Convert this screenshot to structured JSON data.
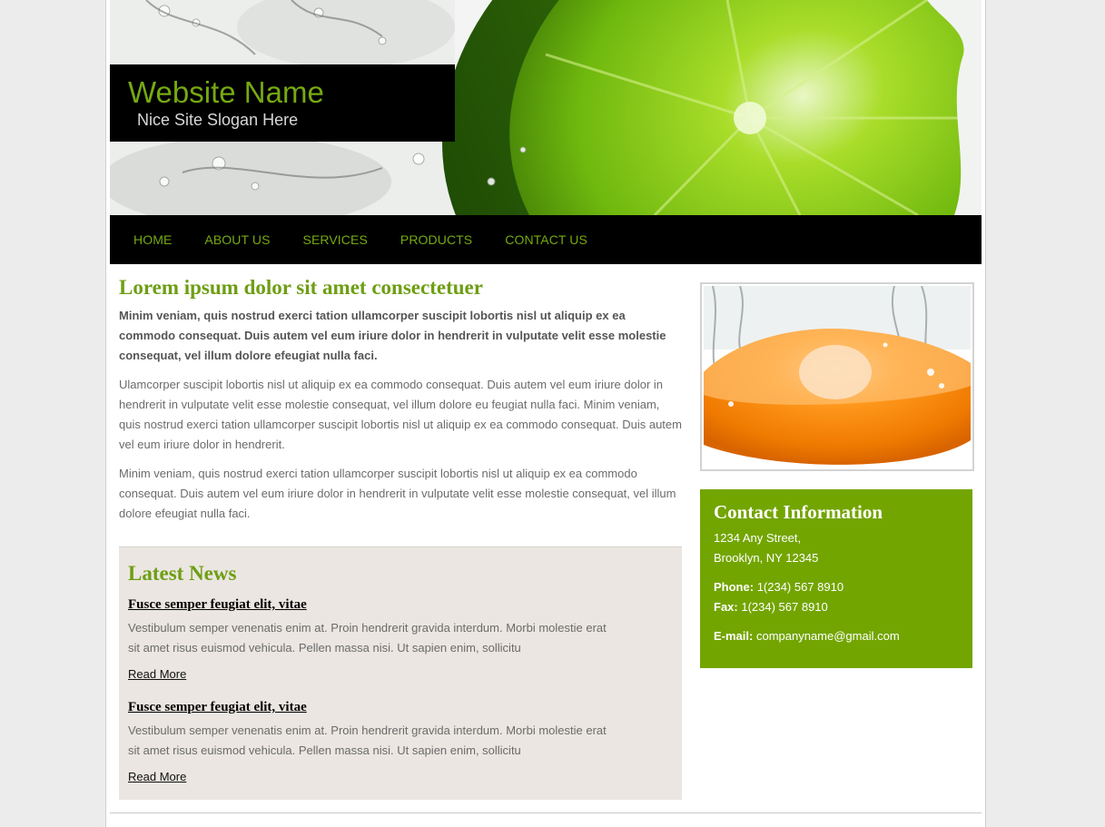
{
  "header": {
    "site_name": "Website Name",
    "slogan": "Nice Site Slogan Here"
  },
  "nav": {
    "items": [
      "HOME",
      "ABOUT US",
      "SERVICES",
      "PRODUCTS",
      "CONTACT US"
    ]
  },
  "main": {
    "headline": "Lorem ipsum dolor sit amet consectetuer",
    "intro": "Minim veniam, quis nostrud exerci tation ullamcorper suscipit lobortis nisl ut aliquip ex ea commodo consequat. Duis autem vel eum iriure dolor in hendrerit in vulputate velit esse molestie consequat, vel illum dolore efeugiat nulla faci.",
    "paragraphs": [
      "Ulamcorper suscipit lobortis nisl ut aliquip ex ea commodo consequat. Duis autem vel eum iriure dolor in hendrerit in vulputate velit esse molestie consequat, vel illum dolore eu feugiat nulla faci. Minim veniam, quis nostrud exerci tation ullamcorper suscipit lobortis nisl ut aliquip ex ea commodo consequat. Duis autem vel eum iriure dolor in hendrerit.",
      "Minim veniam, quis nostrud exerci tation ullamcorper suscipit lobortis nisl ut aliquip ex ea commodo consequat. Duis autem vel eum iriure dolor in hendrerit in vulputate velit esse molestie consequat, vel illum dolore efeugiat nulla faci."
    ]
  },
  "news": {
    "title": "Latest News",
    "items": [
      {
        "heading": "Fusce semper feugiat elit, vitae",
        "text": "Vestibulum semper venenatis enim at. Proin hendrerit gravida interdum. Morbi molestie erat sit amet risus euismod vehicula. Pellen massa nisi. Ut sapien enim, sollicitu",
        "read_more": "Read More"
      },
      {
        "heading": "Fusce semper feugiat elit, vitae",
        "text": "Vestibulum semper venenatis enim at. Proin hendrerit gravida interdum. Morbi molestie erat sit amet risus euismod vehicula. Pellen massa nisi. Ut sapien enim, sollicitu",
        "read_more": "Read More"
      }
    ]
  },
  "contact": {
    "title": "Contact Information",
    "address_line1": "1234 Any Street,",
    "address_line2": "Brooklyn, NY 12345",
    "phone_label": "Phone:",
    "phone": "1(234) 567 8910",
    "fax_label": "Fax:",
    "fax": "1(234) 567 8910",
    "email_label": "E-mail:",
    "email": "companyname@gmail.com"
  },
  "colors": {
    "accent_green": "#76a912",
    "contact_box": "#73a500",
    "news_background": "#ebe6e1",
    "nav_background": "#000000"
  },
  "images": {
    "header_banner": "lime-splash-photo",
    "sidebar_photo": "orange-splash-photo"
  }
}
